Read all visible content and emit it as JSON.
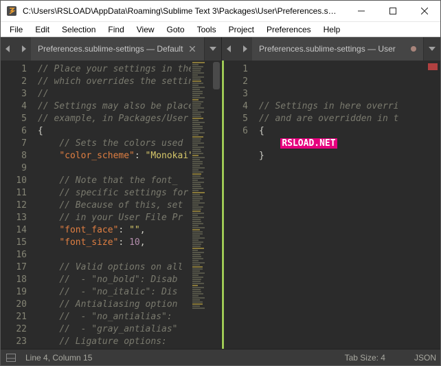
{
  "window": {
    "title": "C:\\Users\\RSLOAD\\AppData\\Roaming\\Sublime Text 3\\Packages\\User\\Preferences.subli..."
  },
  "menu": {
    "items": [
      "File",
      "Edit",
      "Selection",
      "Find",
      "View",
      "Goto",
      "Tools",
      "Project",
      "Preferences",
      "Help"
    ]
  },
  "tabs": {
    "left": {
      "label": "Preferences.sublime-settings — Default"
    },
    "right": {
      "label": "Preferences.sublime-settings — User"
    }
  },
  "left_code": {
    "lines": [
      {
        "n": "1",
        "tokens": [
          {
            "c": "cm",
            "t": "// Place your settings in the"
          }
        ]
      },
      {
        "n": "2",
        "tokens": [
          {
            "c": "cm",
            "t": "// which overrides the settings"
          }
        ]
      },
      {
        "n": "3",
        "tokens": [
          {
            "c": "cm",
            "t": "//"
          }
        ]
      },
      {
        "n": "4",
        "tokens": [
          {
            "c": "cm",
            "t": "// Settings may also be placed"
          }
        ]
      },
      {
        "n": "5",
        "tokens": [
          {
            "c": "cm",
            "t": "// example, in Packages/User"
          }
        ]
      },
      {
        "n": "6",
        "tokens": [
          {
            "c": "punc",
            "t": "{"
          }
        ]
      },
      {
        "n": "7",
        "tokens": [
          {
            "c": "punc",
            "t": "    "
          },
          {
            "c": "cm",
            "t": "// Sets the colors used"
          }
        ]
      },
      {
        "n": "8",
        "tokens": [
          {
            "c": "punc",
            "t": "    "
          },
          {
            "c": "key",
            "t": "\"color_scheme\""
          },
          {
            "c": "punc",
            "t": ": "
          },
          {
            "c": "str",
            "t": "\"Monokai\""
          }
        ]
      },
      {
        "n": "9",
        "tokens": []
      },
      {
        "n": "10",
        "tokens": [
          {
            "c": "punc",
            "t": "    "
          },
          {
            "c": "cm",
            "t": "// Note that the font_"
          }
        ]
      },
      {
        "n": "11",
        "tokens": [
          {
            "c": "punc",
            "t": "    "
          },
          {
            "c": "cm",
            "t": "// specific settings for"
          }
        ]
      },
      {
        "n": "12",
        "tokens": [
          {
            "c": "punc",
            "t": "    "
          },
          {
            "c": "cm",
            "t": "// Because of this, set"
          }
        ]
      },
      {
        "n": "13",
        "tokens": [
          {
            "c": "punc",
            "t": "    "
          },
          {
            "c": "cm",
            "t": "// in your User File Pr"
          }
        ]
      },
      {
        "n": "14",
        "tokens": [
          {
            "c": "punc",
            "t": "    "
          },
          {
            "c": "key",
            "t": "\"font_face\""
          },
          {
            "c": "punc",
            "t": ": "
          },
          {
            "c": "str",
            "t": "\"\""
          },
          {
            "c": "punc",
            "t": ","
          }
        ]
      },
      {
        "n": "15",
        "tokens": [
          {
            "c": "punc",
            "t": "    "
          },
          {
            "c": "key",
            "t": "\"font_size\""
          },
          {
            "c": "punc",
            "t": ": "
          },
          {
            "c": "num",
            "t": "10"
          },
          {
            "c": "punc",
            "t": ","
          }
        ]
      },
      {
        "n": "16",
        "tokens": []
      },
      {
        "n": "17",
        "tokens": [
          {
            "c": "punc",
            "t": "    "
          },
          {
            "c": "cm",
            "t": "// Valid options on all"
          }
        ]
      },
      {
        "n": "18",
        "tokens": [
          {
            "c": "punc",
            "t": "    "
          },
          {
            "c": "cm",
            "t": "//  - \"no_bold\": Disab"
          }
        ]
      },
      {
        "n": "19",
        "tokens": [
          {
            "c": "punc",
            "t": "    "
          },
          {
            "c": "cm",
            "t": "//  - \"no_italic\": Dis"
          }
        ]
      },
      {
        "n": "20",
        "tokens": [
          {
            "c": "punc",
            "t": "    "
          },
          {
            "c": "cm",
            "t": "// Antialiasing option"
          }
        ]
      },
      {
        "n": "21",
        "tokens": [
          {
            "c": "punc",
            "t": "    "
          },
          {
            "c": "cm",
            "t": "//  - \"no_antialias\": "
          }
        ]
      },
      {
        "n": "22",
        "tokens": [
          {
            "c": "punc",
            "t": "    "
          },
          {
            "c": "cm",
            "t": "//  - \"gray_antialias\""
          }
        ]
      },
      {
        "n": "23",
        "tokens": [
          {
            "c": "punc",
            "t": "    "
          },
          {
            "c": "cm",
            "t": "// Ligature options:"
          }
        ]
      }
    ]
  },
  "right_code": {
    "lines": [
      {
        "n": "1",
        "tokens": [
          {
            "c": "cm",
            "t": "// Settings in here overri"
          }
        ]
      },
      {
        "n": "2",
        "tokens": [
          {
            "c": "cm",
            "t": "// and are overridden in t"
          }
        ]
      },
      {
        "n": "3",
        "tokens": [
          {
            "c": "punc",
            "t": "{"
          }
        ]
      },
      {
        "n": "4",
        "tokens": [
          {
            "c": "punc",
            "t": "    "
          },
          {
            "c": "hilite",
            "t": "RSLOAD.NET"
          }
        ]
      },
      {
        "n": "5",
        "tokens": [
          {
            "c": "punc",
            "t": "}"
          }
        ]
      },
      {
        "n": "6",
        "tokens": []
      }
    ]
  },
  "status": {
    "cursor": "Line 4, Column 15",
    "tab_size": "Tab Size: 4",
    "syntax": "JSON"
  }
}
